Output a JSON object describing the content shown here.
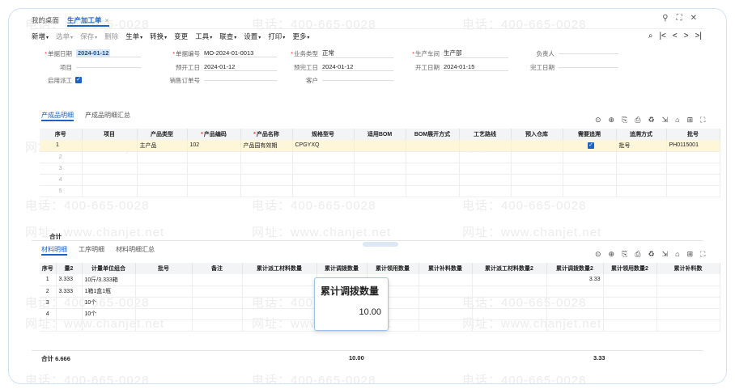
{
  "watermarks": {
    "phone": "电话：400-665-0028",
    "site": "网址：www.chanjet.net"
  },
  "tabs": {
    "home": "我的桌面",
    "active": "生产加工单",
    "close": "×"
  },
  "window": {
    "search": "⚲",
    "expand": "⛶",
    "close": "✕"
  },
  "toolbar": {
    "items": [
      {
        "label": "新增",
        "caret": true,
        "dim": false
      },
      {
        "label": "选单",
        "caret": true,
        "dim": true
      },
      {
        "label": "保存",
        "caret": true,
        "dim": true
      },
      {
        "label": "删除",
        "caret": false,
        "dim": true
      },
      {
        "label": "生单",
        "caret": true,
        "dim": false
      },
      {
        "label": "转换",
        "caret": true,
        "dim": false
      },
      {
        "label": "变更",
        "caret": false,
        "dim": false
      },
      {
        "label": "工具",
        "caret": true,
        "dim": false
      },
      {
        "label": "联查",
        "caret": true,
        "dim": false
      },
      {
        "label": "设置",
        "caret": true,
        "dim": false
      },
      {
        "label": "打印",
        "caret": true,
        "dim": false
      },
      {
        "label": "更多",
        "caret": true,
        "dim": false
      }
    ],
    "nav": {
      "find": "⌕",
      "first": "|<",
      "prev": "<",
      "next": ">",
      "last": ">|"
    }
  },
  "form": {
    "doc_date_label": "单据日期",
    "doc_date": "2024-01-12",
    "doc_no_label": "单据编号",
    "doc_no": "MO-2024-01-0013",
    "biz_type_label": "业务类型",
    "biz_type": "正常",
    "workshop_label": "生产车间",
    "workshop": "生产部",
    "owner_label": "负责人",
    "owner": "",
    "project_label": "项目",
    "project": "",
    "plan_start_label": "预开工日",
    "plan_start": "2024-01-12",
    "plan_end_label": "预完工日",
    "plan_end": "2024-01-12",
    "start_label": "开工日期",
    "start": "2024-01-15",
    "finish_label": "完工日期",
    "finish": "",
    "dispatch_label": "启用派工",
    "sales_order_label": "销售订单号",
    "sales_order": "",
    "customer_label": "客户",
    "customer": ""
  },
  "product_section": {
    "tabs": [
      "产成品明细",
      "产成品明细汇总"
    ],
    "icons": [
      "⊙",
      "⊕",
      "⎘",
      "⎙",
      "♻",
      "⇲",
      "⌂",
      "⊞",
      "⛶"
    ],
    "columns": [
      "序号",
      "项目",
      "产品类型",
      "*产品编码",
      "*产品名称",
      "规格型号",
      "适用BOM",
      "BOM展开方式",
      "工艺路线",
      "预入仓库",
      "需要追溯",
      "追溯方式",
      "批号"
    ],
    "rows": [
      {
        "no": "1",
        "project": "",
        "type": "主产品",
        "code": "102",
        "name": "产品园有效期",
        "spec": "CPGYXQ",
        "bom": "",
        "bom_mode": "",
        "route": "",
        "warehouse": "",
        "trace": true,
        "trace_mode": "批号",
        "batch": "PH0115001"
      },
      {
        "no": "2"
      },
      {
        "no": "3"
      },
      {
        "no": "4"
      },
      {
        "no": "5"
      }
    ],
    "total_label": "合计"
  },
  "material_section": {
    "tabs": [
      "材料明细",
      "工序明细",
      "材料明细汇总"
    ],
    "icons": [
      "⊙",
      "⊕",
      "⎘",
      "⎙",
      "♻",
      "⇲",
      "⌂",
      "⊞",
      "⛶"
    ],
    "columns": [
      "序号",
      "量2",
      "计量单位组合",
      "批号",
      "备注",
      "累计派工材料数量",
      "累计调拨数量",
      "累计领用数量",
      "累计补料数量",
      "累计派工材料数量2",
      "累计调拨数量2",
      "累计领用数量2",
      "累计补料数"
    ],
    "rows": [
      {
        "no": "1",
        "qty2": "3.333",
        "unit": "10斤/3.333箱",
        "transfer2": "3.33"
      },
      {
        "no": "2",
        "qty2": "3.333",
        "unit": "1箱1盒1瓶",
        "transfer2": ""
      },
      {
        "no": "3",
        "qty2": "",
        "unit": "10个",
        "transfer2": ""
      },
      {
        "no": "4",
        "qty2": "",
        "unit": "10个",
        "transfer2": ""
      },
      {
        "no": "",
        "qty2": "",
        "unit": "",
        "transfer2": ""
      }
    ],
    "total_label": "合计",
    "total_qty2": "6.666",
    "total_transfer": "10.00",
    "total_transfer2": "3.33"
  },
  "tooltip": {
    "title": "累计调拨数量",
    "value": "10.00"
  }
}
